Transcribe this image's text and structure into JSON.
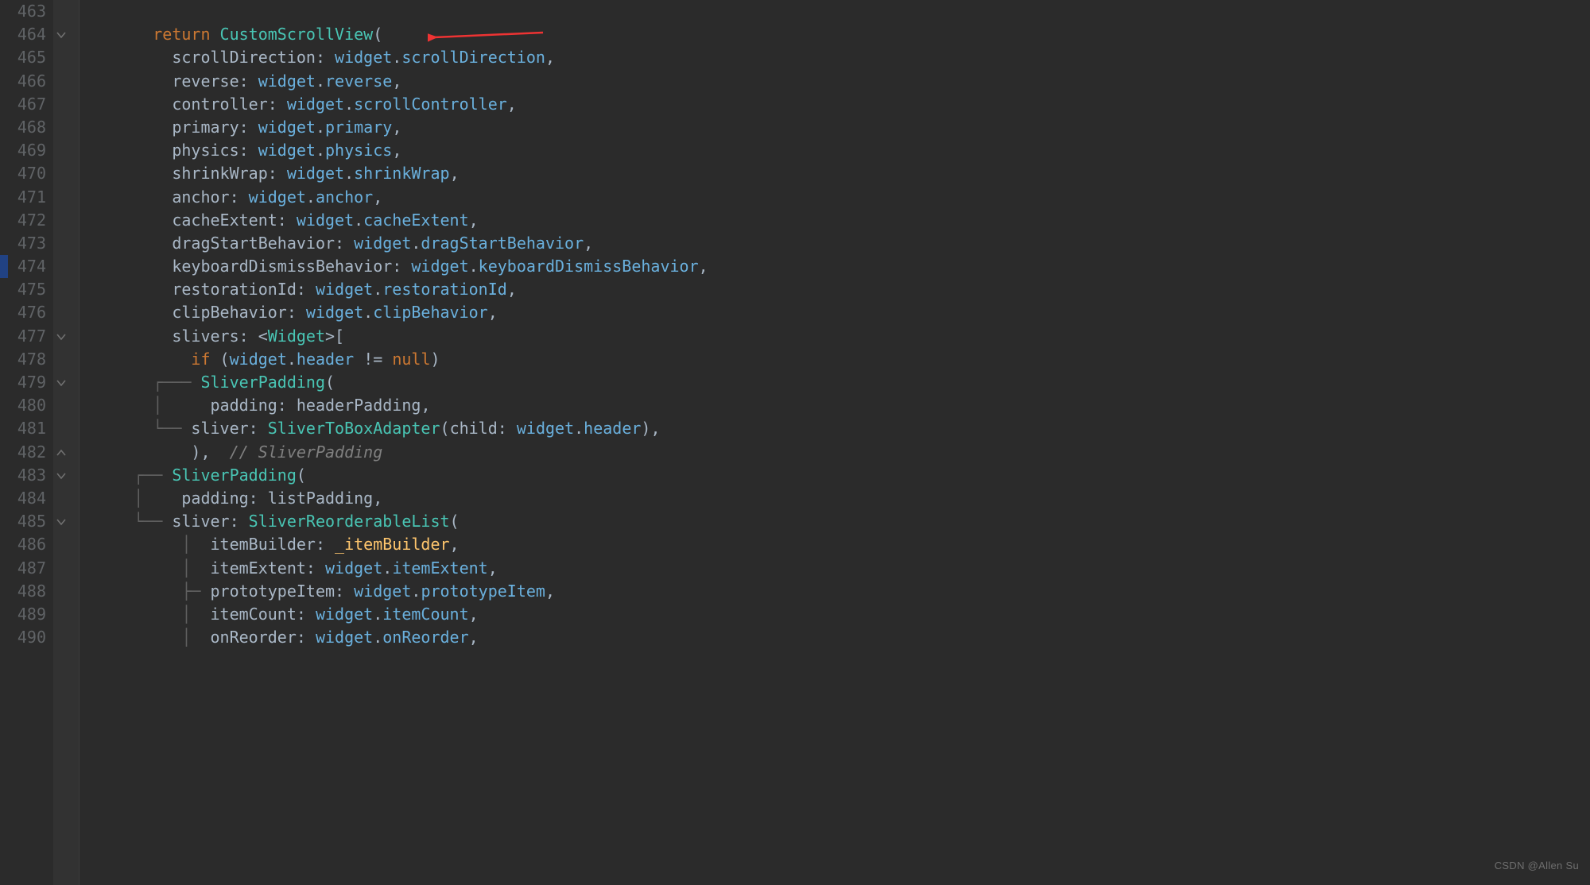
{
  "watermark": "CSDN @Allen Su",
  "line_numbers": [
    "463",
    "464",
    "465",
    "466",
    "467",
    "468",
    "469",
    "470",
    "471",
    "472",
    "473",
    "474",
    "475",
    "476",
    "477",
    "478",
    "479",
    "480",
    "481",
    "482",
    "483",
    "484",
    "485",
    "486",
    "487",
    "488",
    "489",
    "490"
  ],
  "fold_markers": {
    "1": "down",
    "14": "down",
    "16": "down",
    "19": "up",
    "20": "down",
    "22": "down"
  },
  "code_lines": [
    {
      "tokens": [
        {
          "c": "id",
          "t": "      "
        }
      ]
    },
    {
      "tokens": [
        {
          "c": "id",
          "t": "      "
        },
        {
          "c": "k",
          "t": "return"
        },
        {
          "c": "id",
          "t": " "
        },
        {
          "c": "ty",
          "t": "CustomScrollView"
        },
        {
          "c": "p",
          "t": "("
        }
      ]
    },
    {
      "tokens": [
        {
          "c": "id",
          "t": "        "
        },
        {
          "c": "id",
          "t": "scrollDirection"
        },
        {
          "c": "p",
          "t": ": "
        },
        {
          "c": "prop",
          "t": "widget"
        },
        {
          "c": "p",
          "t": "."
        },
        {
          "c": "prop",
          "t": "scrollDirection"
        },
        {
          "c": "p",
          "t": ","
        }
      ]
    },
    {
      "tokens": [
        {
          "c": "id",
          "t": "        "
        },
        {
          "c": "id",
          "t": "reverse"
        },
        {
          "c": "p",
          "t": ": "
        },
        {
          "c": "prop",
          "t": "widget"
        },
        {
          "c": "p",
          "t": "."
        },
        {
          "c": "prop",
          "t": "reverse"
        },
        {
          "c": "p",
          "t": ","
        }
      ]
    },
    {
      "tokens": [
        {
          "c": "id",
          "t": "        "
        },
        {
          "c": "id",
          "t": "controller"
        },
        {
          "c": "p",
          "t": ": "
        },
        {
          "c": "prop",
          "t": "widget"
        },
        {
          "c": "p",
          "t": "."
        },
        {
          "c": "prop",
          "t": "scrollController"
        },
        {
          "c": "p",
          "t": ","
        }
      ]
    },
    {
      "tokens": [
        {
          "c": "id",
          "t": "        "
        },
        {
          "c": "id",
          "t": "primary"
        },
        {
          "c": "p",
          "t": ": "
        },
        {
          "c": "prop",
          "t": "widget"
        },
        {
          "c": "p",
          "t": "."
        },
        {
          "c": "prop",
          "t": "primary"
        },
        {
          "c": "p",
          "t": ","
        }
      ]
    },
    {
      "tokens": [
        {
          "c": "id",
          "t": "        "
        },
        {
          "c": "id",
          "t": "physics"
        },
        {
          "c": "p",
          "t": ": "
        },
        {
          "c": "prop",
          "t": "widget"
        },
        {
          "c": "p",
          "t": "."
        },
        {
          "c": "prop",
          "t": "physics"
        },
        {
          "c": "p",
          "t": ","
        }
      ]
    },
    {
      "tokens": [
        {
          "c": "id",
          "t": "        "
        },
        {
          "c": "id",
          "t": "shrinkWrap"
        },
        {
          "c": "p",
          "t": ": "
        },
        {
          "c": "prop",
          "t": "widget"
        },
        {
          "c": "p",
          "t": "."
        },
        {
          "c": "prop",
          "t": "shrinkWrap"
        },
        {
          "c": "p",
          "t": ","
        }
      ]
    },
    {
      "tokens": [
        {
          "c": "id",
          "t": "        "
        },
        {
          "c": "id",
          "t": "anchor"
        },
        {
          "c": "p",
          "t": ": "
        },
        {
          "c": "prop",
          "t": "widget"
        },
        {
          "c": "p",
          "t": "."
        },
        {
          "c": "prop",
          "t": "anchor"
        },
        {
          "c": "p",
          "t": ","
        }
      ]
    },
    {
      "tokens": [
        {
          "c": "id",
          "t": "        "
        },
        {
          "c": "id",
          "t": "cacheExtent"
        },
        {
          "c": "p",
          "t": ": "
        },
        {
          "c": "prop",
          "t": "widget"
        },
        {
          "c": "p",
          "t": "."
        },
        {
          "c": "prop",
          "t": "cacheExtent"
        },
        {
          "c": "p",
          "t": ","
        }
      ]
    },
    {
      "tokens": [
        {
          "c": "id",
          "t": "        "
        },
        {
          "c": "id",
          "t": "dragStartBehavior"
        },
        {
          "c": "p",
          "t": ": "
        },
        {
          "c": "prop",
          "t": "widget"
        },
        {
          "c": "p",
          "t": "."
        },
        {
          "c": "prop",
          "t": "dragStartBehavior"
        },
        {
          "c": "p",
          "t": ","
        }
      ]
    },
    {
      "tokens": [
        {
          "c": "id",
          "t": "        "
        },
        {
          "c": "id",
          "t": "keyboardDismissBehavior"
        },
        {
          "c": "p",
          "t": ": "
        },
        {
          "c": "prop",
          "t": "widget"
        },
        {
          "c": "p",
          "t": "."
        },
        {
          "c": "prop",
          "t": "keyboardDismissBehavior"
        },
        {
          "c": "p",
          "t": ","
        }
      ]
    },
    {
      "tokens": [
        {
          "c": "id",
          "t": "        "
        },
        {
          "c": "id",
          "t": "restorationId"
        },
        {
          "c": "p",
          "t": ": "
        },
        {
          "c": "prop",
          "t": "widget"
        },
        {
          "c": "p",
          "t": "."
        },
        {
          "c": "prop",
          "t": "restorationId"
        },
        {
          "c": "p",
          "t": ","
        }
      ]
    },
    {
      "tokens": [
        {
          "c": "id",
          "t": "        "
        },
        {
          "c": "id",
          "t": "clipBehavior"
        },
        {
          "c": "p",
          "t": ": "
        },
        {
          "c": "prop",
          "t": "widget"
        },
        {
          "c": "p",
          "t": "."
        },
        {
          "c": "prop",
          "t": "clipBehavior"
        },
        {
          "c": "p",
          "t": ","
        }
      ]
    },
    {
      "tokens": [
        {
          "c": "id",
          "t": "        "
        },
        {
          "c": "id",
          "t": "slivers"
        },
        {
          "c": "p",
          "t": ": <"
        },
        {
          "c": "ty",
          "t": "Widget"
        },
        {
          "c": "p",
          "t": ">["
        }
      ]
    },
    {
      "tokens": [
        {
          "c": "id",
          "t": "          "
        },
        {
          "c": "k",
          "t": "if"
        },
        {
          "c": "p",
          "t": " ("
        },
        {
          "c": "prop",
          "t": "widget"
        },
        {
          "c": "p",
          "t": "."
        },
        {
          "c": "prop",
          "t": "header"
        },
        {
          "c": "p",
          "t": " "
        },
        {
          "c": "op",
          "t": "!="
        },
        {
          "c": "p",
          "t": " "
        },
        {
          "c": "nul",
          "t": "null"
        },
        {
          "c": "p",
          "t": ")"
        }
      ]
    },
    {
      "tokens": [
        {
          "c": "tree",
          "t": "      ┌─── "
        },
        {
          "c": "ty",
          "t": "SliverPadding"
        },
        {
          "c": "p",
          "t": "("
        }
      ]
    },
    {
      "tokens": [
        {
          "c": "tree",
          "t": "      │     "
        },
        {
          "c": "id",
          "t": "padding"
        },
        {
          "c": "p",
          "t": ": "
        },
        {
          "c": "id",
          "t": "headerPadding"
        },
        {
          "c": "p",
          "t": ","
        }
      ]
    },
    {
      "tokens": [
        {
          "c": "tree",
          "t": "      └── "
        },
        {
          "c": "id",
          "t": "sliver"
        },
        {
          "c": "p",
          "t": ": "
        },
        {
          "c": "ty",
          "t": "SliverToBoxAdapter"
        },
        {
          "c": "p",
          "t": "("
        },
        {
          "c": "id",
          "t": "child"
        },
        {
          "c": "p",
          "t": ": "
        },
        {
          "c": "prop",
          "t": "widget"
        },
        {
          "c": "p",
          "t": "."
        },
        {
          "c": "prop",
          "t": "header"
        },
        {
          "c": "p",
          "t": "),"
        }
      ]
    },
    {
      "tokens": [
        {
          "c": "id",
          "t": "          "
        },
        {
          "c": "p",
          "t": "),  "
        },
        {
          "c": "cm",
          "t": "// SliverPadding"
        }
      ]
    },
    {
      "tokens": [
        {
          "c": "tree",
          "t": "    ┌── "
        },
        {
          "c": "ty",
          "t": "SliverPadding"
        },
        {
          "c": "p",
          "t": "("
        }
      ]
    },
    {
      "tokens": [
        {
          "c": "tree",
          "t": "    │    "
        },
        {
          "c": "id",
          "t": "padding"
        },
        {
          "c": "p",
          "t": ": "
        },
        {
          "c": "id",
          "t": "listPadding"
        },
        {
          "c": "p",
          "t": ","
        }
      ]
    },
    {
      "tokens": [
        {
          "c": "tree",
          "t": "    └── "
        },
        {
          "c": "id",
          "t": "sliver"
        },
        {
          "c": "p",
          "t": ": "
        },
        {
          "c": "ty",
          "t": "SliverReorderableList"
        },
        {
          "c": "p",
          "t": "("
        }
      ]
    },
    {
      "tokens": [
        {
          "c": "tree",
          "t": "         │  "
        },
        {
          "c": "id",
          "t": "itemBuilder"
        },
        {
          "c": "p",
          "t": ": "
        },
        {
          "c": "fn",
          "t": "_itemBuilder"
        },
        {
          "c": "p",
          "t": ","
        }
      ]
    },
    {
      "tokens": [
        {
          "c": "tree",
          "t": "         │  "
        },
        {
          "c": "id",
          "t": "itemExtent"
        },
        {
          "c": "p",
          "t": ": "
        },
        {
          "c": "prop",
          "t": "widget"
        },
        {
          "c": "p",
          "t": "."
        },
        {
          "c": "prop",
          "t": "itemExtent"
        },
        {
          "c": "p",
          "t": ","
        }
      ]
    },
    {
      "tokens": [
        {
          "c": "tree",
          "t": "         ├─ "
        },
        {
          "c": "id",
          "t": "prototypeItem"
        },
        {
          "c": "p",
          "t": ": "
        },
        {
          "c": "prop",
          "t": "widget"
        },
        {
          "c": "p",
          "t": "."
        },
        {
          "c": "prop",
          "t": "prototypeItem"
        },
        {
          "c": "p",
          "t": ","
        }
      ]
    },
    {
      "tokens": [
        {
          "c": "tree",
          "t": "         │  "
        },
        {
          "c": "id",
          "t": "itemCount"
        },
        {
          "c": "p",
          "t": ": "
        },
        {
          "c": "prop",
          "t": "widget"
        },
        {
          "c": "p",
          "t": "."
        },
        {
          "c": "prop",
          "t": "itemCount"
        },
        {
          "c": "p",
          "t": ","
        }
      ]
    },
    {
      "tokens": [
        {
          "c": "tree",
          "t": "         │  "
        },
        {
          "c": "id",
          "t": "onReorder"
        },
        {
          "c": "p",
          "t": ": "
        },
        {
          "c": "prop",
          "t": "widget"
        },
        {
          "c": "p",
          "t": "."
        },
        {
          "c": "prop",
          "t": "onReorder"
        },
        {
          "c": "p",
          "t": ","
        }
      ]
    }
  ]
}
